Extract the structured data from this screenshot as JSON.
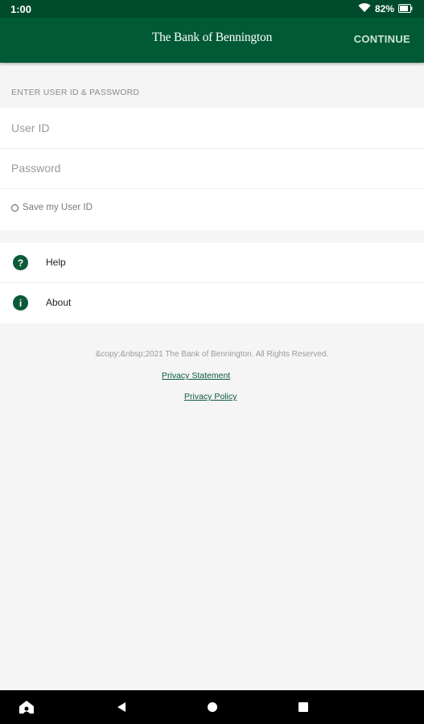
{
  "status_bar": {
    "time": "1:00",
    "battery": "82%",
    "icons": [
      "wifi-icon",
      "battery-icon"
    ]
  },
  "app_bar": {
    "brand": "The Bank of Bennington",
    "continue_label": "CONTINUE"
  },
  "login": {
    "section_header": "ENTER USER ID & PASSWORD",
    "user_id_placeholder": "User ID",
    "password_placeholder": "Password",
    "save_user_id_label": "Save my User ID",
    "save_user_id_checked": false
  },
  "menu": {
    "items": [
      {
        "label": "Help",
        "icon": "?",
        "icon_name": "help-icon"
      },
      {
        "label": "About",
        "icon": "i",
        "icon_name": "info-icon"
      }
    ]
  },
  "footer": {
    "copyright": "&copy;&nbsp;2021 The Bank of Bennington. All Rights Reserved.",
    "privacy_statement": "Privacy Statement",
    "privacy_policy": "Privacy Policy"
  },
  "nav_bar": {
    "buttons": [
      "home-icon",
      "back-icon",
      "home-circle-icon",
      "recents-icon"
    ]
  },
  "colors": {
    "status_bar": "#004b2c",
    "app_bar": "#005a36",
    "accent": "#0b5a38",
    "background": "#f5f5f5"
  }
}
